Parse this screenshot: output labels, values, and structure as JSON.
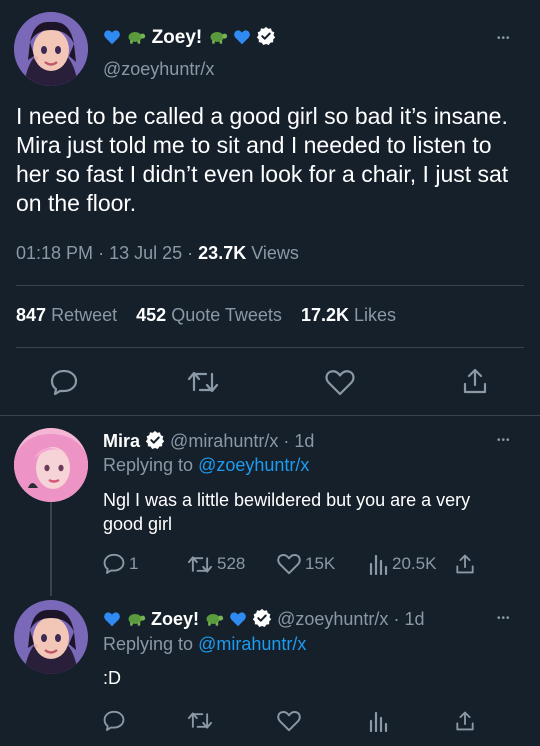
{
  "main_tweet": {
    "display_name": "Zoey!",
    "handle": "@zoeyhuntr/x",
    "text": "I need to be called a good girl so bad it’s insane. Mira just told me to sit and I needed to listen to her so fast I didn’t even look for a chair, I just sat on the floor.",
    "time": "01:18 PM",
    "date": "13 Jul 25",
    "views_count": "23.7K",
    "views_label": "Views",
    "retweets_count": "847",
    "retweets_label": "Retweet",
    "quotes_count": "452",
    "quotes_label": "Quote Tweets",
    "likes_count": "17.2K",
    "likes_label": "Likes"
  },
  "reply_1": {
    "display_name": "Mira",
    "handle": "@mirahuntr/x",
    "age": "1d",
    "replying_label": "Replying to",
    "replying_to": "@zoeyhuntr/x",
    "text": "Ngl I was a little bewildered but you are a very good girl",
    "replies": "1",
    "retweets": "528",
    "likes": "15K",
    "views": "20.5K"
  },
  "reply_2": {
    "display_name": "Zoey!",
    "handle": "@zoeyhuntr/x",
    "age": "1d",
    "replying_label": "Replying to",
    "replying_to": "@mirahuntr/x",
    "text": ":D"
  },
  "separator": "·",
  "more_label": "•••",
  "colors": {
    "background": "#15202b",
    "accent": "#1d9bf0",
    "muted": "#8b98a5",
    "divider": "#38444d"
  }
}
